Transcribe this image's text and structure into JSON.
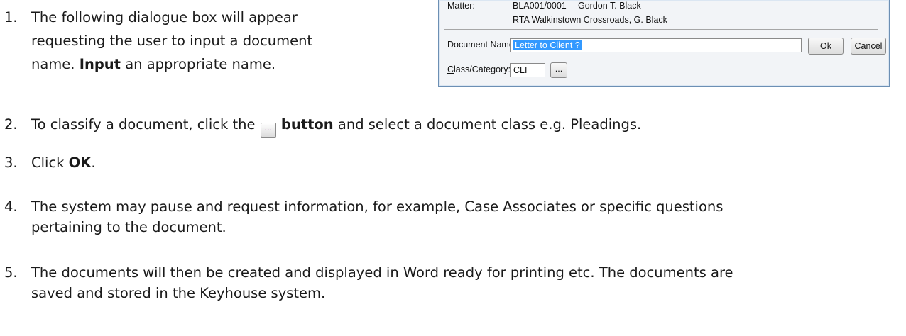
{
  "dialog": {
    "matter_label": "Matter:",
    "matter_code": "BLA001/0001",
    "matter_client": "Gordon T. Black",
    "matter_desc": "RTA Walkinstown Crossroads, G. Black",
    "doc_name_label": "Document Name:",
    "doc_name_value": "Letter to Client ?",
    "class_label": "Class/Category:",
    "class_label_mnemonic": "C",
    "class_label_rest": "lass/Category:",
    "class_value": "CLI",
    "browse_label": "...",
    "ok_label": "Ok",
    "cancel_label": "Cancel"
  },
  "steps": [
    {
      "num": "1.",
      "line1": "The following dialogue box will appear",
      "line2": "requesting the user to input a document",
      "line3_bold": "name. ",
      "line3_pre": "name. ",
      "line3_strong": "Input",
      "line3_post": " an appropriate name."
    },
    {
      "num": "2.",
      "pre": "To classify a document, click the ",
      "btn_glyph": "...",
      "strong": "button",
      "post": " and select a document class e.g. Pleadings."
    },
    {
      "num": "3.",
      "pre": "Click ",
      "strong": "OK",
      "post": "."
    },
    {
      "num": "4.",
      "line1": "The system may pause and request information, for example, Case Associates or specific questions",
      "line2": "pertaining to the document."
    },
    {
      "num": "5.",
      "line1": "The documents will then be created and displayed in Word ready for printing etc. The documents are",
      "line2": "saved and stored in the Keyhouse system."
    }
  ]
}
